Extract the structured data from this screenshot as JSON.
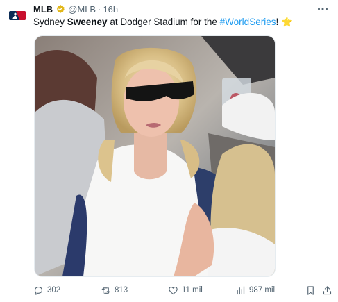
{
  "post": {
    "author": {
      "display_name": "MLB",
      "handle": "@MLB",
      "time": "16h",
      "separator": "·"
    },
    "text": {
      "part1": "Sydney ",
      "bold": "Sweeney",
      "part2": " at Dodger Stadium for the ",
      "hashtag": "#WorldSeries",
      "part3": "! ",
      "star": "⭐"
    },
    "media": {
      "alt": "Photo"
    }
  },
  "actions": {
    "replies": "302",
    "reposts": "813",
    "likes": "11 mil",
    "views": "987 mil"
  },
  "icons": {
    "avatar": "mlb-logo",
    "verified": "gold-verified-badge",
    "more": "more-horizontal-icon",
    "reply": "reply-icon",
    "retweet": "retweet-icon",
    "like": "heart-icon",
    "views": "views-bar-chart-icon",
    "bookmark": "bookmark-icon",
    "share": "share-icon"
  },
  "colors": {
    "text": "#0f1419",
    "secondary": "#536471",
    "link": "#1d9bf0",
    "verified": "#e2b719",
    "mlb_blue": "#0c2c56",
    "mlb_red": "#c8102e"
  }
}
